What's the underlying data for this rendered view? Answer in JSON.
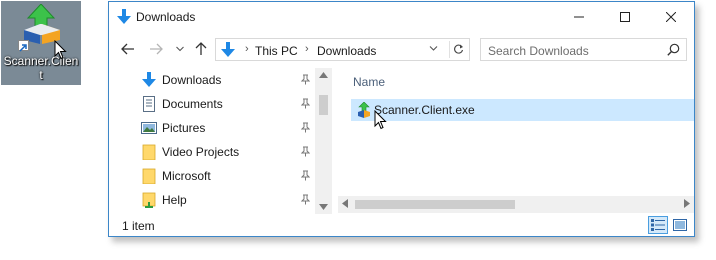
{
  "desktop": {
    "icon_label": "Scanner.Clien t",
    "icon_name": "installer-icon",
    "bg_color": "#7b8a96"
  },
  "window": {
    "title": "Downloads",
    "controls": [
      "minimize",
      "maximize",
      "close"
    ]
  },
  "nav": {
    "buttons": [
      "back-arrow-icon",
      "forward-arrow-icon",
      "recent-dropdown-icon",
      "up-arrow-icon"
    ],
    "breadcrumb": [
      "This PC",
      "Downloads"
    ],
    "search_placeholder": "Search Downloads"
  },
  "sidebar": {
    "items": [
      {
        "label": "Downloads",
        "icon": "download-arrow-icon",
        "pinned": true
      },
      {
        "label": "Documents",
        "icon": "document-icon",
        "pinned": true
      },
      {
        "label": "Pictures",
        "icon": "picture-icon",
        "pinned": true
      },
      {
        "label": "Video Projects",
        "icon": "folder-icon",
        "pinned": true
      },
      {
        "label": "Microsoft",
        "icon": "folder-icon",
        "pinned": true
      },
      {
        "label": "Help",
        "icon": "help-folder-icon",
        "pinned": true
      }
    ]
  },
  "content": {
    "column_header": "Name",
    "files": [
      {
        "name": "Scanner.Client.exe",
        "icon": "installer-icon",
        "selected": true
      }
    ]
  },
  "status": {
    "text": "1 item",
    "views": [
      "details-view-icon",
      "large-icons-view-icon"
    ]
  },
  "colors": {
    "accent": "#3c86c8",
    "selection": "#cce8ff",
    "folder": "#ffd86b",
    "download_blue": "#1e88e5"
  }
}
